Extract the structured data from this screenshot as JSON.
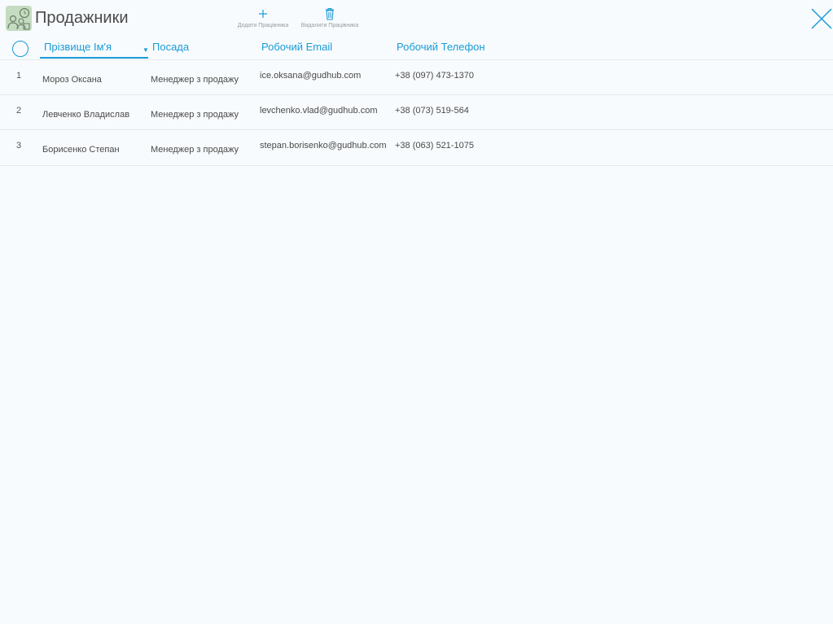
{
  "header": {
    "title": "Продажники",
    "app_icon": "sales-team-icon",
    "add_label": "Додати Працівника",
    "remove_label": "Видалити Працівника",
    "accent_color": "#1a9bd7"
  },
  "columns": {
    "name": "Прізвище Ім'я",
    "position": "Посада",
    "email": "Робочий Email",
    "phone": "Робочий Телефон"
  },
  "rows": [
    {
      "num": "1",
      "name": "Мороз Оксана",
      "position": "Менеджер з продажу",
      "email": "ice.oksana@gudhub.com",
      "phone": "+38 (097) 473-1370"
    },
    {
      "num": "2",
      "name": "Левченко Владислав",
      "position": "Менеджер з продажу",
      "email": "levchenko.vlad@gudhub.com",
      "phone": "+38 (073) 519-564"
    },
    {
      "num": "3",
      "name": "Борисенко Степан",
      "position": "Менеджер з продажу",
      "email": "stepan.borisenko@gudhub.com",
      "phone": "+38 (063) 521-1075"
    }
  ]
}
